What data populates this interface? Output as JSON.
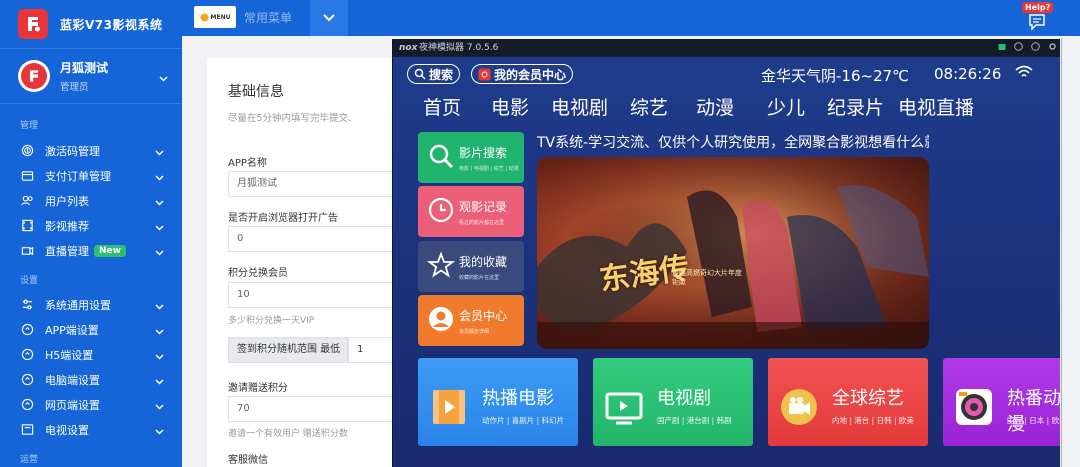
{
  "brand": {
    "title": "蓝彩V73影视系统"
  },
  "user": {
    "name": "月狐测试",
    "role": "管理员"
  },
  "sidebar": {
    "section_manage": "管理",
    "section_settings": "设置",
    "section_ops": "运营",
    "items": [
      {
        "label": "激活码管理",
        "icon": "fingerprint-icon"
      },
      {
        "label": "支付订单管理",
        "icon": "wallet-icon"
      },
      {
        "label": "用户列表",
        "icon": "users-icon"
      },
      {
        "label": "影视推荐",
        "icon": "film-icon"
      },
      {
        "label": "直播管理",
        "icon": "broadcast-icon",
        "badge": "New"
      },
      {
        "label": "系统通用设置",
        "icon": "sliders-icon"
      },
      {
        "label": "APP端设置",
        "icon": "app-icon"
      },
      {
        "label": "H5端设置",
        "icon": "h5-icon"
      },
      {
        "label": "电脑端设置",
        "icon": "desktop-icon"
      },
      {
        "label": "网页端设置",
        "icon": "web-icon"
      },
      {
        "label": "电视设置",
        "icon": "tv-icon"
      }
    ]
  },
  "topbar": {
    "menu_label": "MENU",
    "common_menu": "常用菜单",
    "help_label": "Help?"
  },
  "form": {
    "title": "基础信息",
    "subtitle": "尽量在5分钟内填写完毕提交.",
    "app_name_label": "APP名称",
    "app_name_value": "月狐测试",
    "browser_ad_label": "是否开启浏览器打开广告",
    "browser_ad_value": "0",
    "points_label": "积分兑换会员",
    "points_value": "10",
    "points_hint": "多少积分兑换一天VIP",
    "checkin_label": "签到积分随机范围 最低",
    "checkin_value": "1",
    "invite_label": "邀请赠送积分",
    "invite_value": "70",
    "invite_hint": "邀请一个有效用户 赠送积分数",
    "wechat_label": "客服微信"
  },
  "emulator": {
    "logo": "nox",
    "title": "夜神模拟器 7.0.5.6",
    "search_btn": "搜索",
    "member_btn": "我的会员中心",
    "weather": "金华天气阴-16~27℃",
    "time": "08:26:26",
    "tabs": [
      "首页",
      "电影",
      "电视剧",
      "综艺",
      "动漫",
      "少儿",
      "纪录片",
      "电视直播"
    ],
    "marquee": "TV系统-学习交流、仅供个人研究使用，全网聚合影视想看什么就",
    "side_buttons": [
      {
        "title": "影片搜索",
        "sub": "电影 | 电视剧 | 综艺 | 动漫",
        "color": "#21b46e",
        "icon": "search-icon"
      },
      {
        "title": "观影记录",
        "sub": "看过的影片都在这里",
        "color": "#ec5f78",
        "icon": "history-icon"
      },
      {
        "title": "我的收藏",
        "sub": "收藏的影片在这里",
        "color": "#3a4a7c",
        "icon": "star-icon"
      },
      {
        "title": "会员中心",
        "sub": "会员服务详细",
        "color": "#f07b2c",
        "icon": "user-icon"
      }
    ],
    "tiles": [
      {
        "title": "热播电影",
        "sub": "动作片 | 喜剧片 | 科幻片",
        "color": "#2e8ff0",
        "icon": "film-reel-icon"
      },
      {
        "title": "电视剧",
        "sub": "国产剧 | 港台剧 | 韩剧",
        "color": "#27c070",
        "icon": "tv-screen-icon"
      },
      {
        "title": "全球综艺",
        "sub": "内地 | 港台 | 日韩 | 欧美",
        "color": "#ec4142",
        "icon": "camera-icon"
      },
      {
        "title": "热番动漫",
        "sub": "国产 | 日本 | 欧美",
        "color": "#a22cdc",
        "icon": "lens-icon"
      }
    ],
    "poster": {
      "title": "东海传",
      "caption": "最强高燃奇幻大片年度钜献"
    }
  }
}
